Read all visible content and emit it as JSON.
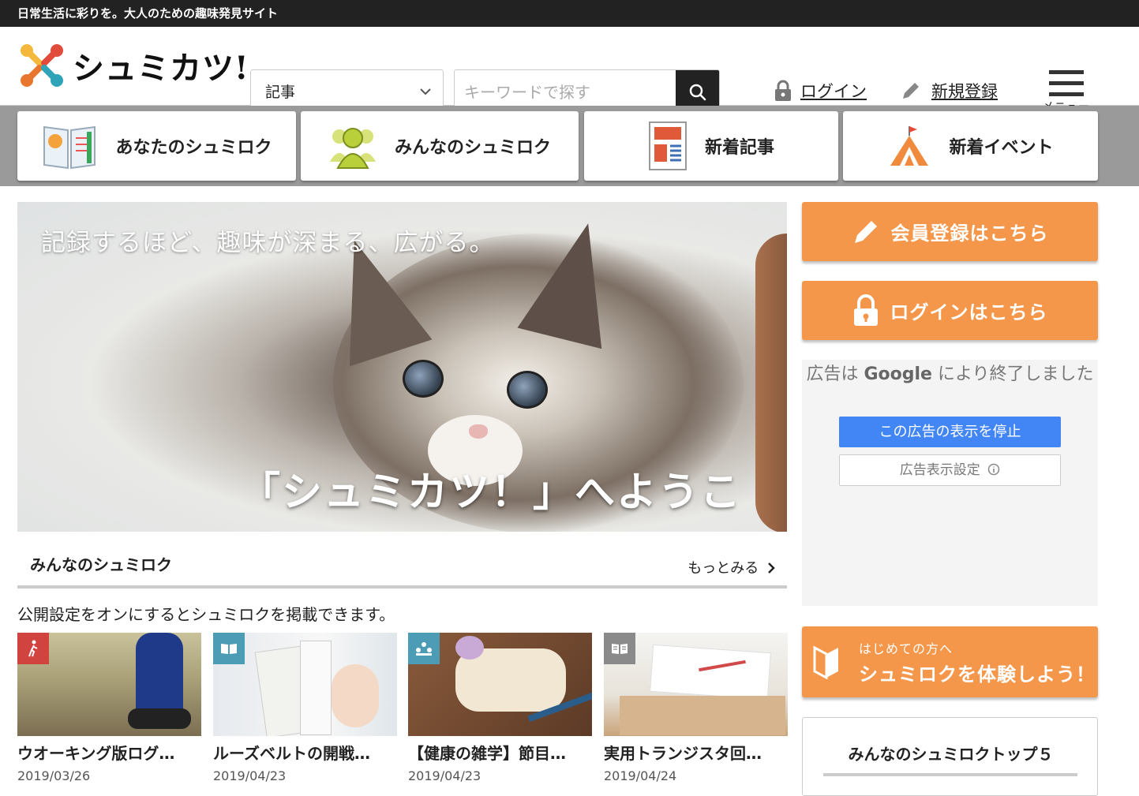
{
  "topbar": {
    "tagline": "日常生活に彩りを。大人のための趣味発見サイト"
  },
  "header": {
    "logo_text": "シュミカツ!",
    "category_select": "記事",
    "search_placeholder": "キーワードで探す",
    "login_label": "ログイン",
    "register_label": "新規登録",
    "menu_label": "メニュー"
  },
  "nav": [
    {
      "label": "あなたのシュミロク",
      "icon": "notebook-icon"
    },
    {
      "label": "みんなのシュミロク",
      "icon": "people-icon"
    },
    {
      "label": "新着記事",
      "icon": "article-icon"
    },
    {
      "label": "新着イベント",
      "icon": "tent-icon"
    }
  ],
  "hero": {
    "caption_top": "記録するほど、趣味が深まる、広がる。",
    "caption_bottom": "「シュミカツ！」へようこそ！"
  },
  "section": {
    "title": "みんなのシュミロク",
    "more_label": "もっとみる",
    "description": "公開設定をオンにするとシュミロクを掲載できます。"
  },
  "cards": [
    {
      "title": "ウオーキング版ログ…",
      "date": "2019/03/26",
      "badge_color": "#d0433f",
      "badge_icon": "walking-icon"
    },
    {
      "title": "ルーズベルトの開戦…",
      "date": "2019/04/23",
      "badge_color": "#4d9cb5",
      "badge_icon": "book-icon"
    },
    {
      "title": "【健康の雑学】節目…",
      "date": "2019/04/23",
      "badge_color": "#4d9cb5",
      "badge_icon": "group-icon"
    },
    {
      "title": "実用トランジスタ回…",
      "date": "2019/04/24",
      "badge_color": "#8a8a8a",
      "badge_icon": "reading-icon"
    }
  ],
  "sidebar": {
    "register_button": "会員登録はこちら",
    "login_button": "ログインはこちら",
    "ad_message_pre": "広告は",
    "ad_brand": "Google",
    "ad_message_post": "により終了しました",
    "ad_stop": "この広告の表示を停止",
    "ad_settings": "広告表示設定",
    "beginner_sub": "はじめての方へ",
    "beginner_main": "シュミロクを体験しよう！",
    "top5_title": "みんなのシュミロクトップ５"
  },
  "colors": {
    "accent_orange": "#f4974b",
    "dark": "#222222",
    "google_blue": "#4285f4"
  }
}
